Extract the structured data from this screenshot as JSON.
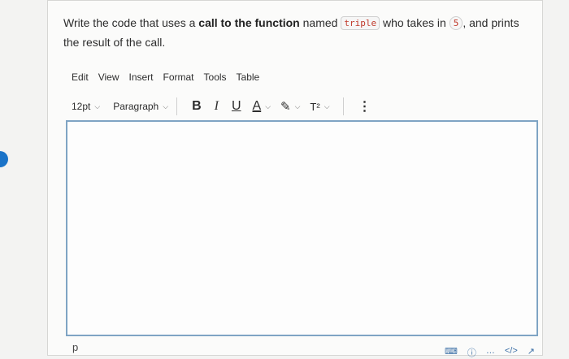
{
  "question": {
    "part1": "Write the code that uses a ",
    "bold": "call to the function",
    "part2": " named ",
    "function_name": "triple",
    "part3": " who takes in ",
    "argument": "5",
    "part4": ", and prints the result of the call."
  },
  "menu": [
    "Edit",
    "View",
    "Insert",
    "Format",
    "Tools",
    "Table"
  ],
  "toolbar": {
    "font_size": "12pt",
    "block_format": "Paragraph",
    "bold": "B",
    "italic": "I",
    "underline": "U",
    "text_color": "A",
    "highlight": "✎",
    "superscript": "T²",
    "more": "⋮"
  },
  "editor": {
    "value": ""
  },
  "statusbar": {
    "path": "p"
  },
  "colors": {
    "accent": "#1a73c8",
    "editor_border": "#7fa4c4",
    "code_text": "#c0392b"
  }
}
